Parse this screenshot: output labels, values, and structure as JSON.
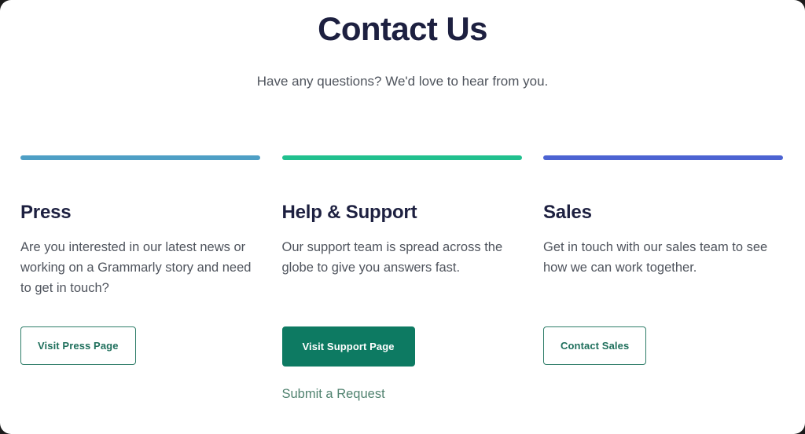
{
  "header": {
    "title": "Contact Us",
    "subtitle": "Have any questions? We'd love to hear from you."
  },
  "colors": {
    "accent_press": "#4e9fc5",
    "accent_support": "#21c08e",
    "accent_sales": "#4c63d2",
    "title_color": "#1d2040",
    "body_color": "#4f545d",
    "button_outline": "#2e7d68",
    "button_solid_bg": "#0d7a62",
    "link_color": "#50826f",
    "card_background": "#ffffff"
  },
  "columns": [
    {
      "id": "press",
      "accent_color": "#4e9fc5",
      "title": "Press",
      "body": "Are you interested in our latest news or working on a Grammarly story and need to get in touch?",
      "button": {
        "label": "Visit Press Page",
        "style": "outline"
      },
      "link": null
    },
    {
      "id": "help-support",
      "accent_color": "#21c08e",
      "title": "Help & Support",
      "body": "Our support team is spread across the globe to give you answers fast.",
      "button": {
        "label": "Visit Support Page",
        "style": "solid"
      },
      "link": {
        "label": "Submit a Request"
      }
    },
    {
      "id": "sales",
      "accent_color": "#4c63d2",
      "title": "Sales",
      "body": "Get in touch with our sales team to see how we can work together.",
      "button": {
        "label": "Contact Sales",
        "style": "outline"
      },
      "link": null
    }
  ]
}
